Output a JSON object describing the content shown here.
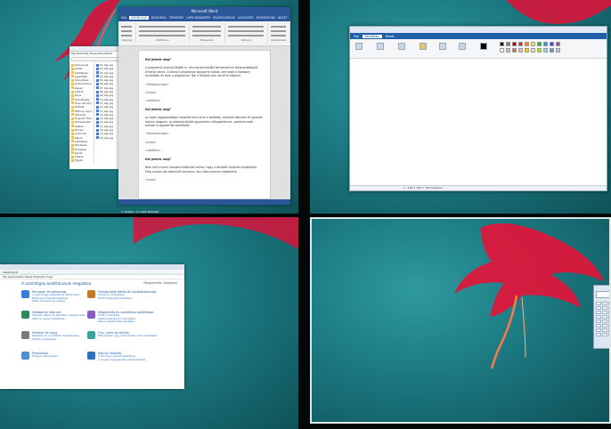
{
  "word": {
    "title": "Microsoft Word",
    "tabs": [
      "FÁJL",
      "KEZDŐLAP",
      "BESZÚRÁS",
      "TERVEZÉS",
      "LAPELRENDEZÉS",
      "HIVATKOZÁSOK",
      "LEVELEZÉS",
      "KORREKTÚRA",
      "NÉZET"
    ],
    "ribbon_groups": [
      "Vágólap",
      "Betűtípus",
      "Bekezdés",
      "Stílusok",
      "Szerkesztés"
    ],
    "paragraphs": [
      {
        "kind": "h",
        "text": "Hol jelenik meg?"
      },
      {
        "kind": "p",
        "text": "A programot azonnal ötödik el, ami mindenekelőtt kényelmet és felhasználóbarát élményt jelent. A könnyű programok egyszerre futnak, ami segít a hatékony munkában és ezen a programon. Bár a feladat nem zárult le teljesen."
      },
      {
        "kind": "code",
        "text": "<Windows-logó>"
      },
      {
        "kind": "code",
        "text": "<Lista>"
      },
      {
        "kind": "code",
        "text": "<Letöltés>"
      },
      {
        "kind": "h",
        "text": "Hol jelenik meg?"
      },
      {
        "kind": "p",
        "text": "Az egyik leggyakrabban használt funkció ez a beállítás, amellyel könnyen és gyorsan tudunk dolgozni. Az ablakok között egyszerűen váltogathatunk, valamint ezek mérete is egyszerűen kezelhető."
      },
      {
        "kind": "code",
        "text": "<Windows-logó>"
      },
      {
        "kind": "code",
        "text": "<Lista>"
      },
      {
        "kind": "code",
        "text": "<Letöltés>"
      },
      {
        "kind": "h",
        "text": "Hol jelenik meg?"
      },
      {
        "kind": "p",
        "text": "Nem kell a menü ikonjaira kattintani ahhoz, hogy a keresett funkciót megtaláljuk. Elég csupán pár billentyűt lenyomni, és a lista azonnal megjelenik."
      },
      {
        "kind": "code",
        "text": "<Lista>"
      }
    ],
    "status": "1. OLDAL / 3    1 SZÓ    MAGYAR"
  },
  "explorer": {
    "menu": "Fájl   Kezdőlap   Megosztás   Nézet",
    "tree": [
      "Kedvencek",
      "Asztal",
      "Letöltések",
      "Legutóbbi",
      "Könyvtárak",
      "Dokumentumok",
      "Képek",
      "Videók",
      "Zene",
      "Számítógép",
      "Helyi lemez (C:)",
      "Hálózat",
      "Otthoni csoport",
      "Windows",
      "Program Files",
      "Felhasználók",
      "Adatok",
      "Munka",
      "Archívum",
      "Képek",
      "Letöltések",
      "Mentések",
      "Projektek",
      "Zenék",
      "Videók",
      "Egyéb"
    ],
    "files": [
      "01_kép.jpg",
      "02_kép.jpg",
      "03_kép.jpg",
      "04_kép.jpg",
      "05_kép.jpg",
      "06_kép.jpg",
      "07_kép.jpg",
      "08_kép.jpg",
      "09_kép.jpg",
      "10_kép.jpg",
      "11_kép.jpg",
      "12_kép.jpg",
      "13_kép.jpg",
      "14_kép.jpg",
      "15_kép.jpg",
      "16_kép.jpg",
      "17_kép.jpg",
      "18_kép.jpg",
      "19_kép.jpg",
      "20_kép.jpg"
    ]
  },
  "paint": {
    "tabs": [
      "Fájl",
      "Kezdőlap",
      "Nézet"
    ],
    "status": "1 : 100    1 200 × 700 képpont",
    "palette": [
      "#000000",
      "#7f7f7f",
      "#880015",
      "#ed1c24",
      "#ff7f27",
      "#fff200",
      "#22b14c",
      "#00a2e8",
      "#3f48cc",
      "#a349a4",
      "#ffffff",
      "#c3c3c3",
      "#b97a57",
      "#ffaec9",
      "#ffc90e",
      "#efe4b0",
      "#b5e61d",
      "#99d9ea",
      "#7092be",
      "#c8bfe7"
    ]
  },
  "control_panel": {
    "address": "Vezérlőpult",
    "menu": "Fájl   Szerkesztés   Nézet   Eszközök   Súgó",
    "heading": "A számítógép beállításainak megadása",
    "view_by": "Megjelenítés: Kategória",
    "categories": [
      {
        "title": "Rendszer és biztonság",
        "subs": [
          "A számítógép állapotának áttekintése",
          "Biztonsági másolat készítése",
          "Hibák keresése és javítása"
        ],
        "color": "#3a7bd5"
      },
      {
        "title": "Hálózat és internet",
        "subs": [
          "Hálózati állapot és feladatok megtekintése",
          "Otthoni csoport beállításai"
        ],
        "color": "#2e8b57"
      },
      {
        "title": "Hardver és hang",
        "subs": [
          "Eszközök és nyomtatók megtekintése",
          "Eszköz hozzáadása"
        ],
        "color": "#7a7a7a"
      },
      {
        "title": "Programok",
        "subs": [
          "Program eltávolítása"
        ],
        "color": "#4c8fd0"
      },
      {
        "title": "Felhasználói fiókok és családbiztonság",
        "subs": [
          "Fióktípus módosítása",
          "Szülői felügyelet beállítása"
        ],
        "color": "#c57a2a"
      },
      {
        "title": "Megjelenés és személyes beállítások",
        "subs": [
          "Téma módosítása",
          "Asztal hátterének módosítása",
          "Képernyőfelbontás beállítása"
        ],
        "color": "#8a5cc2"
      },
      {
        "title": "Óra, nyelv és terület",
        "subs": [
          "Billentyűzet vagy más beviteli mód módosítása"
        ],
        "color": "#3aa0a0"
      },
      {
        "title": "Könnyű kezelés",
        "subs": [
          "A Windows javasolt beállításai",
          "A vizuális megjelenítés optimalizálása"
        ],
        "color": "#2f6fbf"
      }
    ]
  },
  "colors": {
    "word_blue": "#2b579a",
    "paint_blue": "#1f5fa8",
    "wallpaper": "#1c7a82",
    "flower": "#e0163a"
  }
}
